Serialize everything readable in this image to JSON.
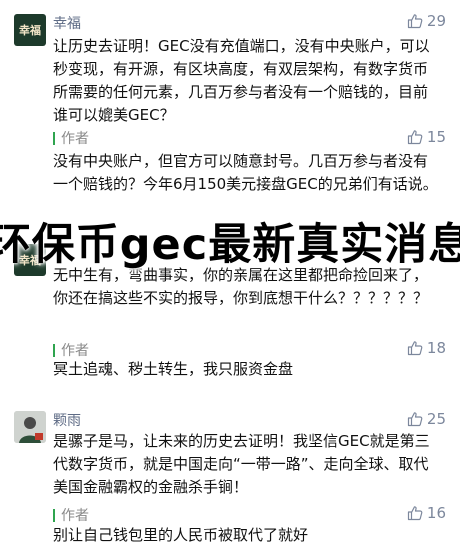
{
  "banner": {
    "title": "环保币gec最新真实消息"
  },
  "comments": [
    {
      "user": "幸福",
      "avatar_text": "幸福",
      "likes": "29",
      "text": "让历史去证明！GEC没有充值端口，没有中央账户，可以秒变现，有开源，有区块高度，有双层架构，有数字货币所需要的任何元素，几百万参与者没有一个赔钱的，目前谁可以媲美GEC？",
      "reply": {
        "author": "作者",
        "likes": "15",
        "text": "没有中央账户，但官方可以随意封号。几百万参与者没有一个赔钱的？今年6月150美元接盘GEC的兄弟们有话说。"
      }
    },
    {
      "user": "",
      "avatar_text": "幸福",
      "likes": "",
      "text": "无中生有，弯曲事实，你的亲属在这里都把命捡回来了，你还在搞这些不实的报导，你到底想干什么？？？？？？",
      "reply": {
        "author": "作者",
        "likes": "18",
        "text": "冥土追魂、秽土转生，我只服资金盘"
      }
    },
    {
      "user": "颗雨",
      "avatar_text": "",
      "likes": "25",
      "text": "是骡子是马，让未来的历史去证明！我坚信GEC就是第三代数字货币，就是中国走向“一带一路”、走向全球、取代美国金融霸权的金融杀手锏！",
      "reply": {
        "author": "作者",
        "likes": "16",
        "text": "别让自己钱包里的人民币被取代了就好"
      }
    }
  ],
  "colors": {
    "nickname": "#5e6b85",
    "like": "#7c879c",
    "author_bar": "#2fa44f",
    "avatar_dark": "#1d3a2b"
  },
  "icons": {
    "like": "thumb-up-icon"
  }
}
